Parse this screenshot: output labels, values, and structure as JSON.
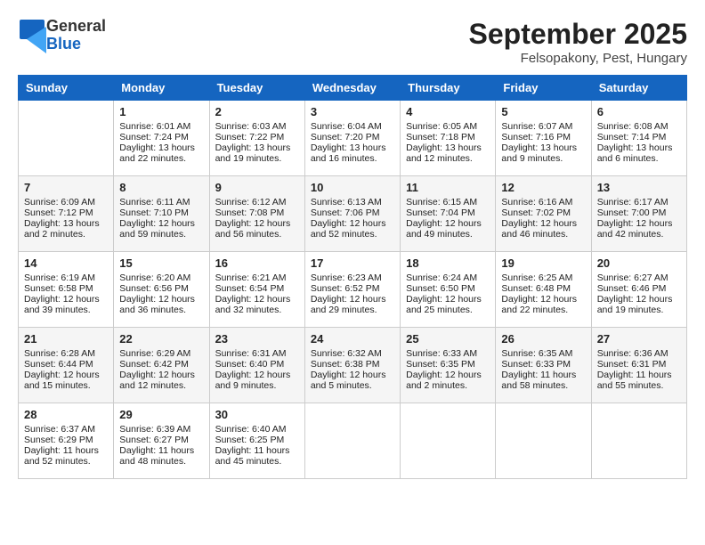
{
  "header": {
    "logo_general": "General",
    "logo_blue": "Blue",
    "title": "September 2025",
    "subtitle": "Felsopakony, Pest, Hungary"
  },
  "weekdays": [
    "Sunday",
    "Monday",
    "Tuesday",
    "Wednesday",
    "Thursday",
    "Friday",
    "Saturday"
  ],
  "weeks": [
    [
      {
        "day": "",
        "sunrise": "",
        "sunset": "",
        "daylight": ""
      },
      {
        "day": "1",
        "sunrise": "Sunrise: 6:01 AM",
        "sunset": "Sunset: 7:24 PM",
        "daylight": "Daylight: 13 hours and 22 minutes."
      },
      {
        "day": "2",
        "sunrise": "Sunrise: 6:03 AM",
        "sunset": "Sunset: 7:22 PM",
        "daylight": "Daylight: 13 hours and 19 minutes."
      },
      {
        "day": "3",
        "sunrise": "Sunrise: 6:04 AM",
        "sunset": "Sunset: 7:20 PM",
        "daylight": "Daylight: 13 hours and 16 minutes."
      },
      {
        "day": "4",
        "sunrise": "Sunrise: 6:05 AM",
        "sunset": "Sunset: 7:18 PM",
        "daylight": "Daylight: 13 hours and 12 minutes."
      },
      {
        "day": "5",
        "sunrise": "Sunrise: 6:07 AM",
        "sunset": "Sunset: 7:16 PM",
        "daylight": "Daylight: 13 hours and 9 minutes."
      },
      {
        "day": "6",
        "sunrise": "Sunrise: 6:08 AM",
        "sunset": "Sunset: 7:14 PM",
        "daylight": "Daylight: 13 hours and 6 minutes."
      }
    ],
    [
      {
        "day": "7",
        "sunrise": "Sunrise: 6:09 AM",
        "sunset": "Sunset: 7:12 PM",
        "daylight": "Daylight: 13 hours and 2 minutes."
      },
      {
        "day": "8",
        "sunrise": "Sunrise: 6:11 AM",
        "sunset": "Sunset: 7:10 PM",
        "daylight": "Daylight: 12 hours and 59 minutes."
      },
      {
        "day": "9",
        "sunrise": "Sunrise: 6:12 AM",
        "sunset": "Sunset: 7:08 PM",
        "daylight": "Daylight: 12 hours and 56 minutes."
      },
      {
        "day": "10",
        "sunrise": "Sunrise: 6:13 AM",
        "sunset": "Sunset: 7:06 PM",
        "daylight": "Daylight: 12 hours and 52 minutes."
      },
      {
        "day": "11",
        "sunrise": "Sunrise: 6:15 AM",
        "sunset": "Sunset: 7:04 PM",
        "daylight": "Daylight: 12 hours and 49 minutes."
      },
      {
        "day": "12",
        "sunrise": "Sunrise: 6:16 AM",
        "sunset": "Sunset: 7:02 PM",
        "daylight": "Daylight: 12 hours and 46 minutes."
      },
      {
        "day": "13",
        "sunrise": "Sunrise: 6:17 AM",
        "sunset": "Sunset: 7:00 PM",
        "daylight": "Daylight: 12 hours and 42 minutes."
      }
    ],
    [
      {
        "day": "14",
        "sunrise": "Sunrise: 6:19 AM",
        "sunset": "Sunset: 6:58 PM",
        "daylight": "Daylight: 12 hours and 39 minutes."
      },
      {
        "day": "15",
        "sunrise": "Sunrise: 6:20 AM",
        "sunset": "Sunset: 6:56 PM",
        "daylight": "Daylight: 12 hours and 36 minutes."
      },
      {
        "day": "16",
        "sunrise": "Sunrise: 6:21 AM",
        "sunset": "Sunset: 6:54 PM",
        "daylight": "Daylight: 12 hours and 32 minutes."
      },
      {
        "day": "17",
        "sunrise": "Sunrise: 6:23 AM",
        "sunset": "Sunset: 6:52 PM",
        "daylight": "Daylight: 12 hours and 29 minutes."
      },
      {
        "day": "18",
        "sunrise": "Sunrise: 6:24 AM",
        "sunset": "Sunset: 6:50 PM",
        "daylight": "Daylight: 12 hours and 25 minutes."
      },
      {
        "day": "19",
        "sunrise": "Sunrise: 6:25 AM",
        "sunset": "Sunset: 6:48 PM",
        "daylight": "Daylight: 12 hours and 22 minutes."
      },
      {
        "day": "20",
        "sunrise": "Sunrise: 6:27 AM",
        "sunset": "Sunset: 6:46 PM",
        "daylight": "Daylight: 12 hours and 19 minutes."
      }
    ],
    [
      {
        "day": "21",
        "sunrise": "Sunrise: 6:28 AM",
        "sunset": "Sunset: 6:44 PM",
        "daylight": "Daylight: 12 hours and 15 minutes."
      },
      {
        "day": "22",
        "sunrise": "Sunrise: 6:29 AM",
        "sunset": "Sunset: 6:42 PM",
        "daylight": "Daylight: 12 hours and 12 minutes."
      },
      {
        "day": "23",
        "sunrise": "Sunrise: 6:31 AM",
        "sunset": "Sunset: 6:40 PM",
        "daylight": "Daylight: 12 hours and 9 minutes."
      },
      {
        "day": "24",
        "sunrise": "Sunrise: 6:32 AM",
        "sunset": "Sunset: 6:38 PM",
        "daylight": "Daylight: 12 hours and 5 minutes."
      },
      {
        "day": "25",
        "sunrise": "Sunrise: 6:33 AM",
        "sunset": "Sunset: 6:35 PM",
        "daylight": "Daylight: 12 hours and 2 minutes."
      },
      {
        "day": "26",
        "sunrise": "Sunrise: 6:35 AM",
        "sunset": "Sunset: 6:33 PM",
        "daylight": "Daylight: 11 hours and 58 minutes."
      },
      {
        "day": "27",
        "sunrise": "Sunrise: 6:36 AM",
        "sunset": "Sunset: 6:31 PM",
        "daylight": "Daylight: 11 hours and 55 minutes."
      }
    ],
    [
      {
        "day": "28",
        "sunrise": "Sunrise: 6:37 AM",
        "sunset": "Sunset: 6:29 PM",
        "daylight": "Daylight: 11 hours and 52 minutes."
      },
      {
        "day": "29",
        "sunrise": "Sunrise: 6:39 AM",
        "sunset": "Sunset: 6:27 PM",
        "daylight": "Daylight: 11 hours and 48 minutes."
      },
      {
        "day": "30",
        "sunrise": "Sunrise: 6:40 AM",
        "sunset": "Sunset: 6:25 PM",
        "daylight": "Daylight: 11 hours and 45 minutes."
      },
      {
        "day": "",
        "sunrise": "",
        "sunset": "",
        "daylight": ""
      },
      {
        "day": "",
        "sunrise": "",
        "sunset": "",
        "daylight": ""
      },
      {
        "day": "",
        "sunrise": "",
        "sunset": "",
        "daylight": ""
      },
      {
        "day": "",
        "sunrise": "",
        "sunset": "",
        "daylight": ""
      }
    ]
  ]
}
